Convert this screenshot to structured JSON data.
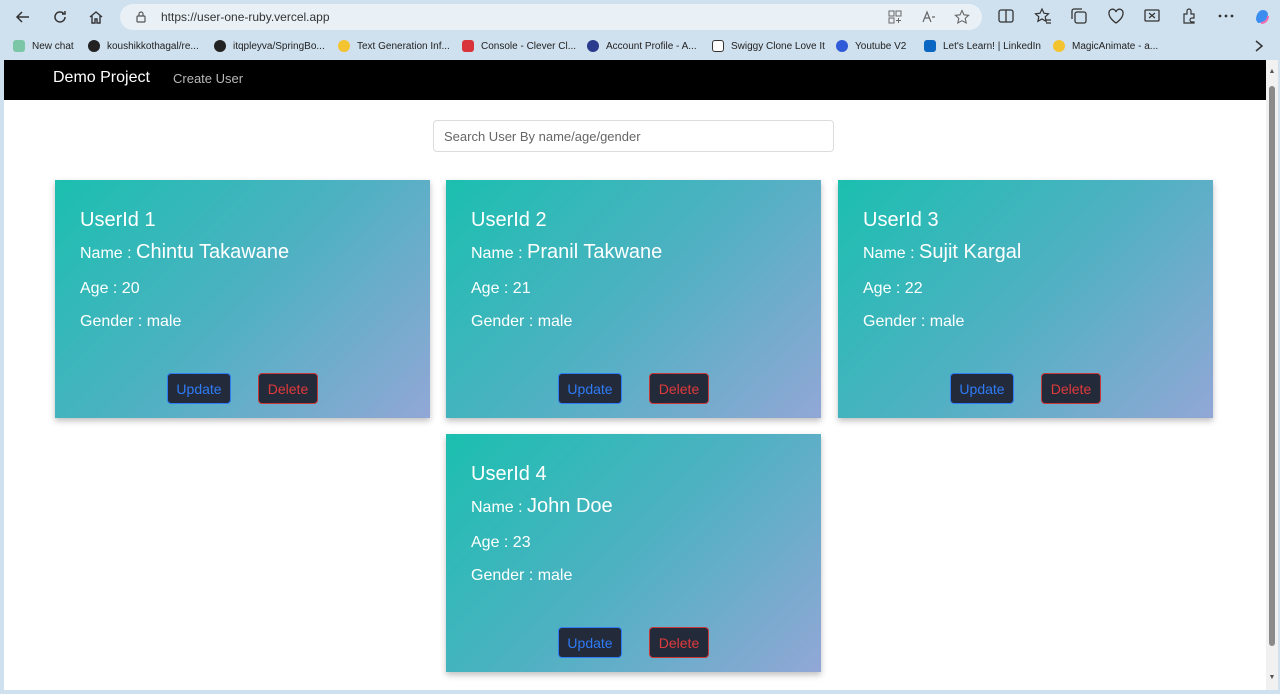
{
  "browser": {
    "url": "https://user-one-ruby.vercel.app",
    "bookmarks": [
      {
        "label": "New chat",
        "color": "#7cc6a8"
      },
      {
        "label": "koushikkothagal/re...",
        "color": "#222222"
      },
      {
        "label": "itqpleyva/SpringBo...",
        "color": "#222222"
      },
      {
        "label": "Text Generation Inf...",
        "color": "#f4c430"
      },
      {
        "label": "Console - Clever Cl...",
        "color": "#d9343c"
      },
      {
        "label": "Account Profile - A...",
        "color": "#2a3a8c"
      },
      {
        "label": "Swiggy Clone Love It",
        "color": "#ffffff"
      },
      {
        "label": "Youtube V2",
        "color": "#2f5bd8"
      },
      {
        "label": "Let's Learn! | LinkedIn",
        "color": "#0a66c2"
      },
      {
        "label": "MagicAnimate - a...",
        "color": "#f4c430"
      }
    ]
  },
  "app": {
    "brand": "Demo Project",
    "nav_link": "Create User",
    "search_placeholder": "Search User By name/age/gender",
    "name_prefix": "Name :",
    "update_label": "Update",
    "delete_label": "Delete",
    "users": [
      {
        "userid": "UserId 1",
        "name": "Chintu Takawane",
        "age": "Age : 20",
        "gender": "Gender : male"
      },
      {
        "userid": "UserId 2",
        "name": "Pranil Takwane",
        "age": "Age : 21",
        "gender": "Gender : male"
      },
      {
        "userid": "UserId 3",
        "name": "Sujit Kargal",
        "age": "Age : 22",
        "gender": "Gender : male"
      },
      {
        "userid": "UserId 4",
        "name": "John Doe",
        "age": "Age : 23",
        "gender": "Gender : male"
      }
    ]
  }
}
